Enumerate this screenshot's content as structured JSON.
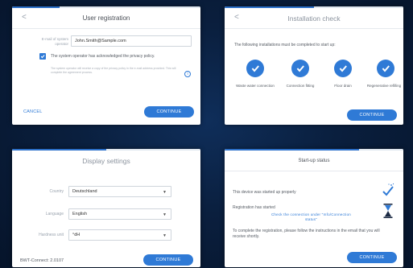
{
  "screens": {
    "registration": {
      "back": "<",
      "title": "User registration",
      "email_label": "E-mail of system operator",
      "email_value": "John.Smith@Sample.com",
      "privacy_text": "The system operator has acknowledged the privacy policy.",
      "note_text": "The system operator will receive a copy of the privacy policy in the e-mail address provided. This will complete the agreement process.",
      "cancel": "CANCEL",
      "continue": "CONTINUE",
      "progress": 0.25
    },
    "installation": {
      "back": "<",
      "title": "Installation check",
      "intro": "The following installations must be completed to start up:",
      "items": [
        "Waste water connection",
        "Connection fitting",
        "Floor drain",
        "Regenerative refilling"
      ],
      "continue": "CONTINUE",
      "progress": 0.5
    },
    "display": {
      "title": "Display settings",
      "country_label": "Country",
      "country_value": "Deutschland",
      "language_label": "Language",
      "language_value": "English",
      "hardness_label": "Hardness unit",
      "hardness_value": "°dH",
      "version": "BWT-Connect: 2.0107",
      "continue": "CONTINUE",
      "progress": 0.5
    },
    "startup": {
      "title": "Start-up status",
      "started": "This device was started up properly",
      "registration": "Registration has started",
      "check_link": "Check the connection under \"Info/Connection status\"",
      "instructions": "To complete the registration, please follow the instructions in the email that you will receive shortly.",
      "continue": "CONTINUE",
      "progress": 0.75
    }
  },
  "colors": {
    "accent": "#2f7ad6",
    "background": "#0a1f3e"
  }
}
